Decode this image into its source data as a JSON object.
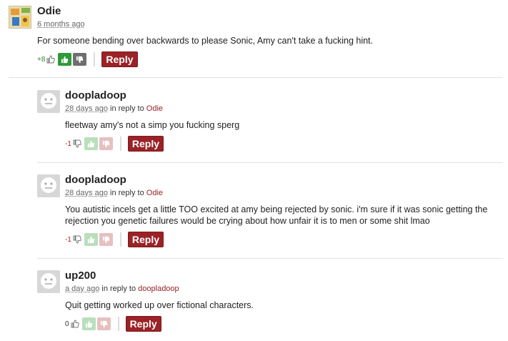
{
  "comments": [
    {
      "author": "Odie",
      "time": "6 months ago",
      "body": "For someone bending over backwards to please Sonic, Amy can't take a fucking hint.",
      "score": "+8",
      "reply_label": "Reply"
    },
    {
      "author": "doopladoop",
      "time": "28 days ago",
      "in_reply_to_label": "in reply to",
      "reply_to": "Odie",
      "body": "fleetway amy's not a simp you fucking sperg",
      "score": "-1",
      "reply_label": "Reply"
    },
    {
      "author": "doopladoop",
      "time": "28 days ago",
      "in_reply_to_label": "in reply to",
      "reply_to": "Odie",
      "body": "You autistic incels get a little TOO excited at amy being rejected by sonic. i'm sure if it was sonic getting the rejection you genetic failures would be crying about how unfair it is to men or some shit lmao",
      "score": "-1",
      "reply_label": "Reply"
    },
    {
      "author": "up200",
      "time": "a day ago",
      "in_reply_to_label": "in reply to",
      "reply_to": "doopladoop",
      "body": "Quit getting worked up over fictional characters.",
      "score": "0",
      "reply_label": "Reply"
    }
  ],
  "icons": {
    "thumbs_up": "thumbs-up-icon",
    "thumbs_down": "thumbs-down-icon",
    "avatar_default": "default-avatar-icon"
  },
  "colors": {
    "reply_button": "#9b2226",
    "upvote_active": "#2f9a3a",
    "reply_link": "#9b2226"
  }
}
